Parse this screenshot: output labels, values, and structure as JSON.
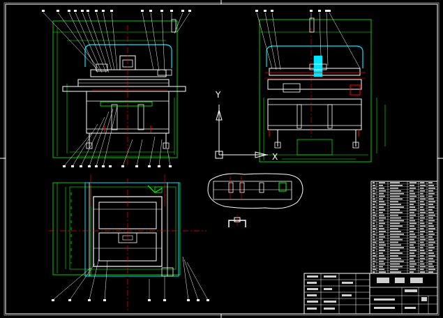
{
  "drawing": {
    "background": "#000000",
    "colors": {
      "frame": "#ffffff",
      "part": "#ffffff",
      "dimension": "#00ff00",
      "center": "#ff0000",
      "hidden": "#00ffff",
      "leader": "#ffff00",
      "blue": "#3333ff",
      "cyan": "#00e5ff",
      "gray": "#8c8c8c"
    },
    "ucs": {
      "y_label": "Y",
      "x_label": "X"
    },
    "views": [
      {
        "id": "front-view"
      },
      {
        "id": "side-view"
      },
      {
        "id": "top-view"
      },
      {
        "id": "detail-view"
      },
      {
        "id": "bracket-view"
      }
    ],
    "parts_list": {
      "rows": 34
    },
    "title_block": {
      "rows": 6
    }
  }
}
